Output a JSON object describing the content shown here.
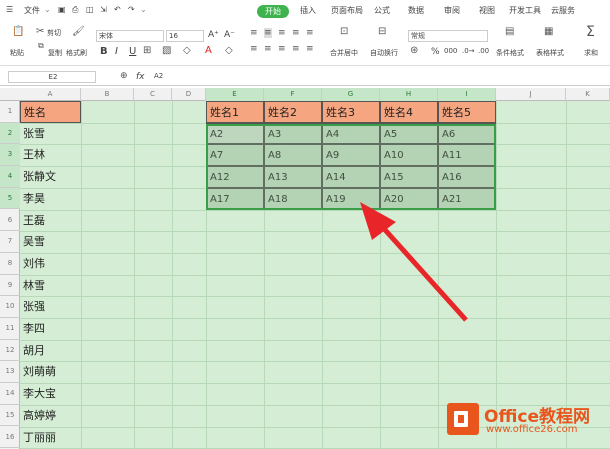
{
  "menu": {
    "file": "文件",
    "start": "开始",
    "insert": "插入",
    "layout": "页面布局",
    "formula": "公式",
    "data": "数据",
    "review": "审阅",
    "view": "视图",
    "dev": "开发工具",
    "cloud": "云服务"
  },
  "ribbon": {
    "paste": "粘贴",
    "cut": "剪切",
    "copy": "复制",
    "format_painter": "格式刷",
    "font_name": "宋体",
    "font_size": "16",
    "bold": "B",
    "italic": "I",
    "underline": "U",
    "font_grow": "A⁺",
    "font_shrink": "A⁻",
    "merge_center": "合并居中",
    "wrap": "自动换行",
    "number_format": "常规",
    "percent": "%",
    "cond_format": "条件格式",
    "table_style": "表格样式",
    "sum": "求和"
  },
  "formula_bar": {
    "name_box": "E2",
    "fx": "fx",
    "value": "A2"
  },
  "columns": [
    "A",
    "B",
    "C",
    "D",
    "E",
    "F",
    "G",
    "H",
    "I",
    "J",
    "K"
  ],
  "rows": [
    "1",
    "2",
    "3",
    "4",
    "5",
    "6",
    "7",
    "8",
    "9",
    "10",
    "11",
    "12",
    "13",
    "14",
    "15",
    "16"
  ],
  "col_a": [
    "姓名",
    "张雪",
    "王林",
    "张静文",
    "李昊",
    "王磊",
    "吴雪",
    "刘伟",
    "林雪",
    "张强",
    "李四",
    "胡月",
    "刘萌萌",
    "李大宝",
    "高婷婷",
    "丁丽丽"
  ],
  "table": {
    "headers": [
      "姓名1",
      "姓名2",
      "姓名3",
      "姓名4",
      "姓名5"
    ],
    "rows": [
      [
        "A2",
        "A3",
        "A4",
        "A5",
        "A6"
      ],
      [
        "A7",
        "A8",
        "A9",
        "A10",
        "A11"
      ],
      [
        "A12",
        "A13",
        "A14",
        "A15",
        "A16"
      ],
      [
        "A17",
        "A18",
        "A19",
        "A20",
        "A21"
      ]
    ]
  },
  "watermark": {
    "brand": "Office教程网",
    "url": "www.office26.com"
  },
  "colors": {
    "header_fill": "#f5a57f",
    "grid_bg": "#d4edd4",
    "selection": "#9ec39e",
    "accent": "#3fb34f",
    "arrow": "#e8262a",
    "logo": "#e8561e"
  }
}
